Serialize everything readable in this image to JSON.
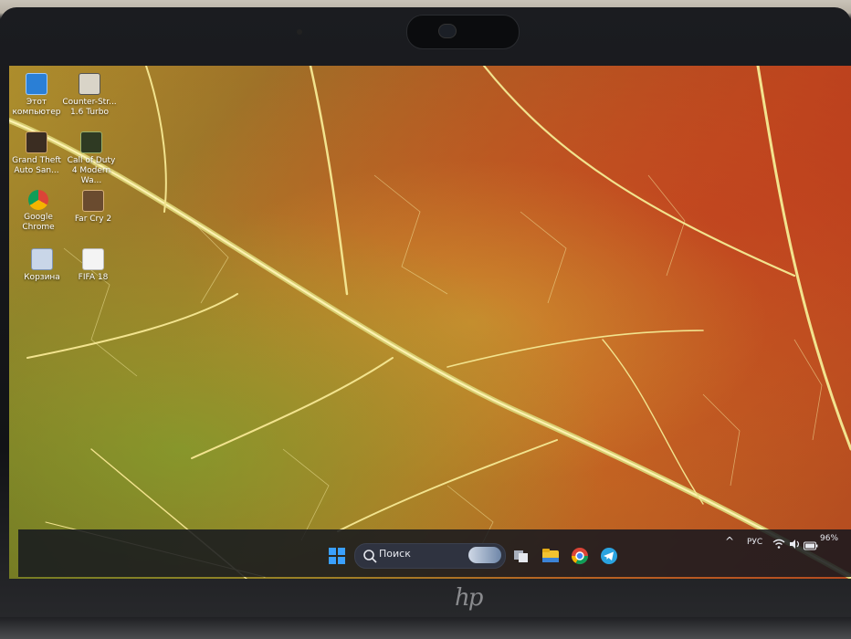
{
  "desktop": {
    "icons": [
      {
        "label": "Этот компьютер",
        "icon": "this-pc-icon"
      },
      {
        "label": "Counter-Str... 1.6 Turbo",
        "icon": "counter-strike-icon"
      },
      {
        "label": "Grand Theft Auto San...",
        "icon": "gta-san-andreas-icon"
      },
      {
        "label": "Call of Duty 4 Modern Wa...",
        "icon": "call-of-duty-icon"
      },
      {
        "label": "Google Chrome",
        "icon": "chrome-icon"
      },
      {
        "label": "Far Cry 2",
        "icon": "far-cry-icon"
      },
      {
        "label": "Корзина",
        "icon": "recycle-bin-icon"
      },
      {
        "label": "FIFA 18",
        "icon": "document-icon"
      }
    ]
  },
  "taskbar": {
    "search_placeholder": "Поиск",
    "pinned": [
      "start-icon",
      "search-icon",
      "task-view-icon",
      "file-explorer-icon",
      "chrome-icon",
      "telegram-icon"
    ]
  },
  "tray": {
    "chevron": "^",
    "language": "РУС",
    "battery_percent": "96%"
  },
  "brand": {
    "logo_text": "hp"
  }
}
